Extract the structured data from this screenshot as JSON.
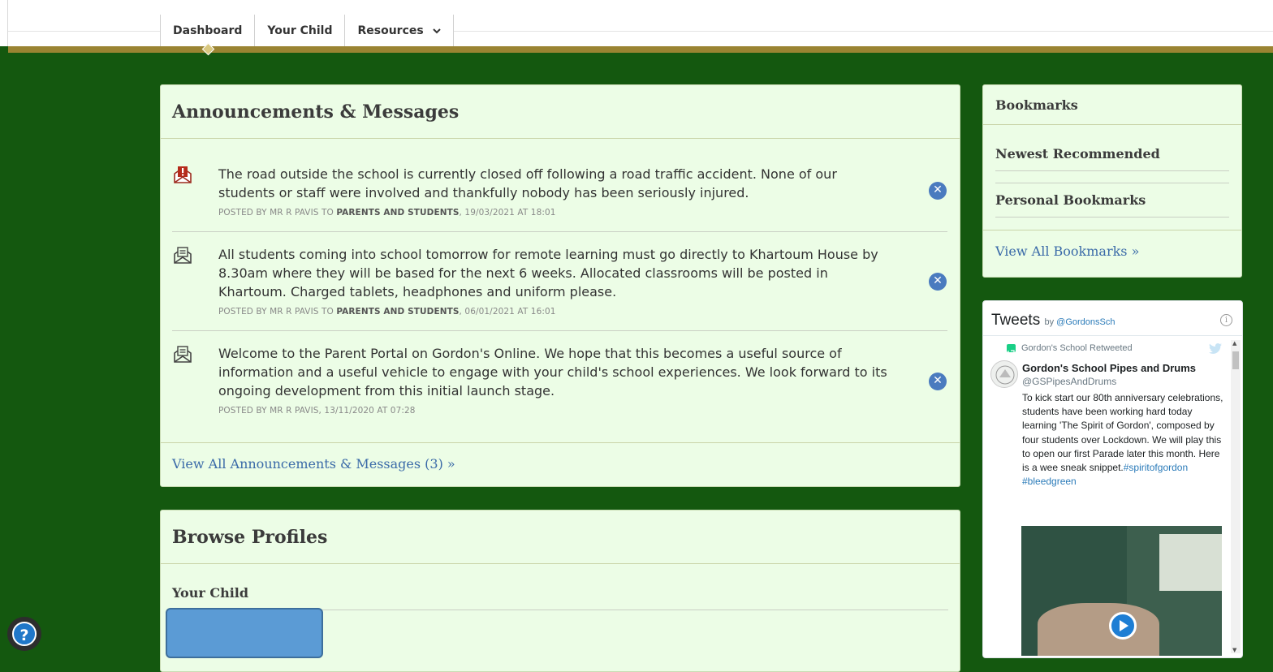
{
  "nav": {
    "tabs": [
      {
        "label": "Dashboard"
      },
      {
        "label": "Your Child"
      },
      {
        "label": "Resources"
      }
    ]
  },
  "announcements": {
    "title": "Announcements & Messages",
    "messages": [
      {
        "icon": "envelope-alert-icon",
        "text": "The road outside the school is currently closed off following a road traffic accident. None of our students or staff were involved and thankfully nobody has been seriously injured.",
        "meta_prefix": "POSTED BY MR R PAVIS TO ",
        "meta_audience": "PARENTS AND STUDENTS",
        "meta_suffix": ", 19/03/2021 AT 18:01"
      },
      {
        "icon": "envelope-icon",
        "text": "All students coming into school tomorrow for remote learning must go directly to Khartoum House by 8.30am where they will be based for the next 6 weeks. Allocated classrooms will be posted in Khartoum. Charged tablets, headphones and uniform please.",
        "meta_prefix": "POSTED BY MR R PAVIS TO ",
        "meta_audience": "PARENTS AND STUDENTS",
        "meta_suffix": ", 06/01/2021 AT 16:01"
      },
      {
        "icon": "envelope-icon",
        "text": "Welcome to the Parent Portal on Gordon's Online. We hope that this becomes a useful source of information and a useful vehicle to engage with your child's school experiences. We look forward to its ongoing development from this initial launch stage.",
        "meta_prefix": "POSTED BY MR R PAVIS, 13/11/2020 AT 07:28",
        "meta_audience": "",
        "meta_suffix": ""
      }
    ],
    "view_all": "View All Announcements & Messages (3) »"
  },
  "profiles": {
    "title": "Browse Profiles",
    "subtitle": "Your Child"
  },
  "bookmarks": {
    "title": "Bookmarks",
    "newest": "Newest Recommended",
    "personal": "Personal Bookmarks",
    "view_all": "View All Bookmarks »"
  },
  "tweets": {
    "title": "Tweets",
    "by": "by",
    "handle": "@GordonsSch",
    "retweeted": "Gordon's School Retweeted",
    "author": "Gordon's School Pipes and Drums",
    "author_handle": "@GSPipesAndDrums",
    "body": "To kick start our 80th anniversary celebrations, students have been working hard today learning 'The Spirit of Gordon', composed by four students over Lockdown. We will play this to open our first Parade later this month. Here is a wee sneak snippet.",
    "hashtag1": "#spiritofgordon",
    "hashtag2": "#bleedgreen"
  },
  "help": {
    "label": "?"
  },
  "colors": {
    "background": "#14580f",
    "gold": "#9a8432",
    "panel": "#ecfde6",
    "link": "#3a6aa8",
    "close": "#4a7bbf"
  }
}
